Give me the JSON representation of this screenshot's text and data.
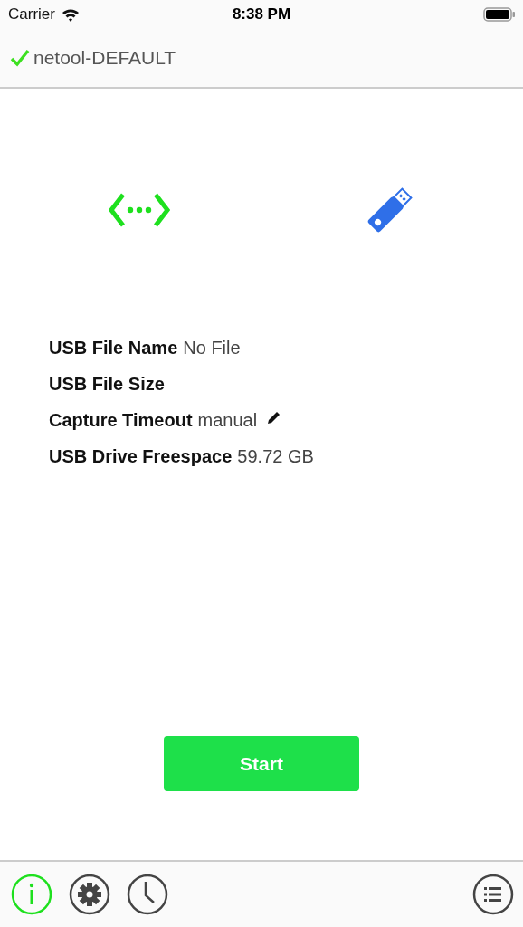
{
  "status_bar": {
    "carrier": "Carrier",
    "time": "8:38 PM"
  },
  "nav_bar": {
    "title": "netool-DEFAULT",
    "connected": true
  },
  "info": [
    {
      "label": "USB File Name",
      "value": "No File",
      "editable": false
    },
    {
      "label": "USB File Size",
      "editable": false
    },
    {
      "label": "Capture Timeout",
      "value": "manual",
      "editable": true
    },
    {
      "label": "USB Drive Freespace",
      "value": "59.72 GB",
      "editable": false
    }
  ],
  "start_button": {
    "label": "Start"
  },
  "tab_bar": [
    {
      "kind": "info",
      "selected": true
    },
    {
      "kind": "settings",
      "selected": false
    },
    {
      "kind": "history",
      "selected": false
    },
    {
      "kind": "list",
      "selected": false
    }
  ]
}
